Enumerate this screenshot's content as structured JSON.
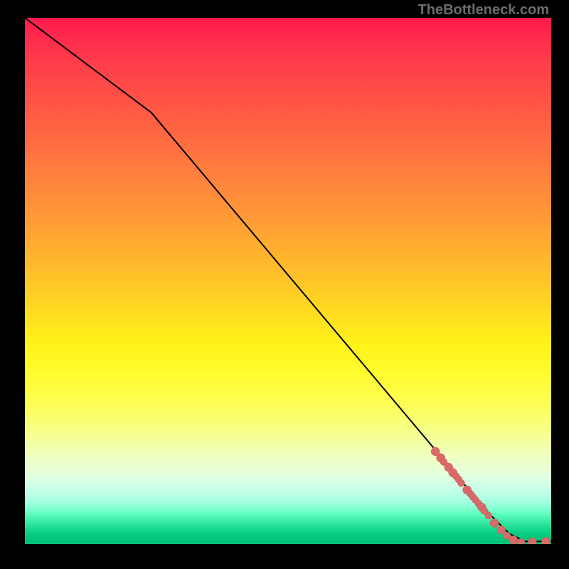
{
  "watermark": "TheBottleneck.com",
  "colors": {
    "line": "#000000",
    "marker_fill": "#d86a6a",
    "marker_stroke": "#c45a5a"
  },
  "chart_data": {
    "type": "line",
    "title": "",
    "xlabel": "",
    "ylabel": "",
    "xlim": [
      0,
      100
    ],
    "ylim": [
      0,
      100
    ],
    "grid": false,
    "line": {
      "x": [
        0,
        24,
        88,
        92,
        95,
        100
      ],
      "y": [
        100,
        82,
        6,
        2,
        0.5,
        0.5
      ]
    },
    "markers": {
      "comment": "Scatter points overlaid on the lower-right tail of the curve; estimated from pixel positions.",
      "x": [
        78.0,
        79.0,
        79.6,
        80.5,
        81.3,
        81.9,
        82.4,
        82.9,
        84.0,
        84.6,
        85.1,
        85.6,
        86.2,
        86.8,
        87.3,
        88.1,
        89.2,
        90.5,
        91.6,
        92.8,
        94.3,
        96.4,
        99.0
      ],
      "y": [
        17.6,
        16.4,
        15.6,
        14.6,
        13.6,
        12.9,
        12.3,
        11.6,
        10.3,
        9.6,
        9.0,
        8.4,
        7.7,
        7.0,
        6.3,
        5.4,
        4.0,
        2.7,
        1.6,
        0.8,
        0.4,
        0.4,
        0.5
      ],
      "r": [
        6,
        6,
        5,
        6,
        6,
        5,
        5,
        5,
        6,
        5,
        5,
        5,
        5,
        6,
        5,
        5,
        6,
        6,
        5,
        6,
        5,
        6,
        6
      ]
    }
  }
}
